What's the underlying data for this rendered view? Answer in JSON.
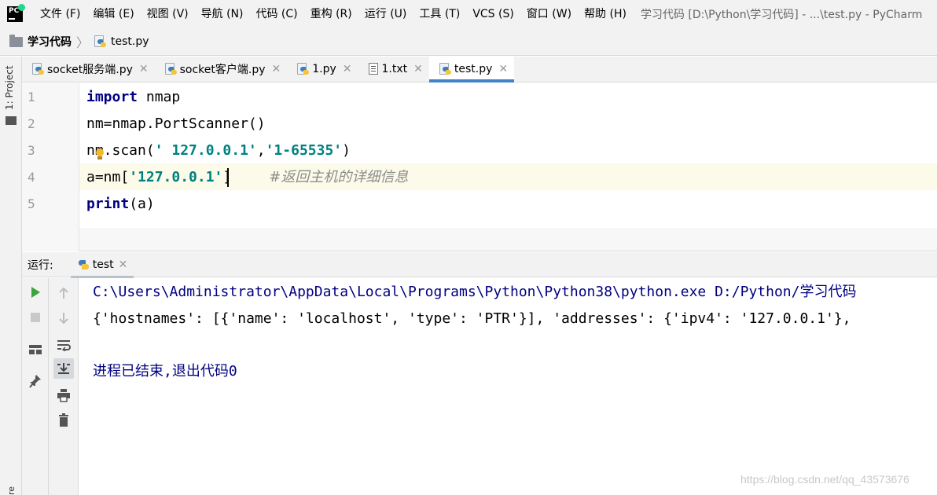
{
  "menubar": {
    "items": [
      "文件 (F)",
      "编辑 (E)",
      "视图 (V)",
      "导航 (N)",
      "代码 (C)",
      "重构 (R)",
      "运行 (U)",
      "工具 (T)",
      "VCS (S)",
      "窗口 (W)",
      "帮助 (H)"
    ],
    "window_title": "学习代码 [D:\\Python\\学习代码] - ...\\test.py - PyCharm"
  },
  "breadcrumb": {
    "project": "学习代码",
    "file": "test.py"
  },
  "left_strip": {
    "project_tool": "1: Project",
    "structure_tool": "re"
  },
  "tabs": [
    {
      "label": "socket服务端.py",
      "icon": "python-file-icon",
      "active": false
    },
    {
      "label": "socket客户端.py",
      "icon": "python-file-icon",
      "active": false
    },
    {
      "label": "1.py",
      "icon": "python-file-icon",
      "active": false
    },
    {
      "label": "1.txt",
      "icon": "text-file-icon",
      "active": false
    },
    {
      "label": "test.py",
      "icon": "python-file-icon",
      "active": true
    }
  ],
  "editor": {
    "line_numbers": [
      "1",
      "2",
      "3",
      "4",
      "5"
    ],
    "current_line": 4,
    "lines": {
      "l1": {
        "kw": "import",
        "rest": " nmap"
      },
      "l2": {
        "text": "nm=nmap.PortScanner()"
      },
      "l3": {
        "a": "nm.scan(",
        "s1": "' 127.0.0.1'",
        "b": ",",
        "s2": "'1-65535'",
        "c": ")"
      },
      "l4": {
        "a": "a=nm[",
        "s": "'127.0.0.1'",
        "b": "]",
        "comment": "#返回主机的详细信息"
      },
      "l5": {
        "kw": "print",
        "rest": "(a)"
      }
    }
  },
  "run_panel": {
    "label": "运行:",
    "tab_label": "test",
    "console": {
      "command": "C:\\Users\\Administrator\\AppData\\Local\\Programs\\Python\\Python38\\python.exe D:/Python/学习代码",
      "output": "{'hostnames': [{'name': 'localhost', 'type': 'PTR'}], 'addresses': {'ipv4': '127.0.0.1'},",
      "exit_message": "进程已结束,退出代码0"
    }
  },
  "watermark": "https://blog.csdn.net/qq_43573676",
  "colors": {
    "keyword": "#000080",
    "string": "#008080",
    "comment": "#8c8c8c",
    "run_green": "#3ea33e",
    "active_tab_underline": "#4083c9",
    "current_line": "#fcfae8"
  }
}
